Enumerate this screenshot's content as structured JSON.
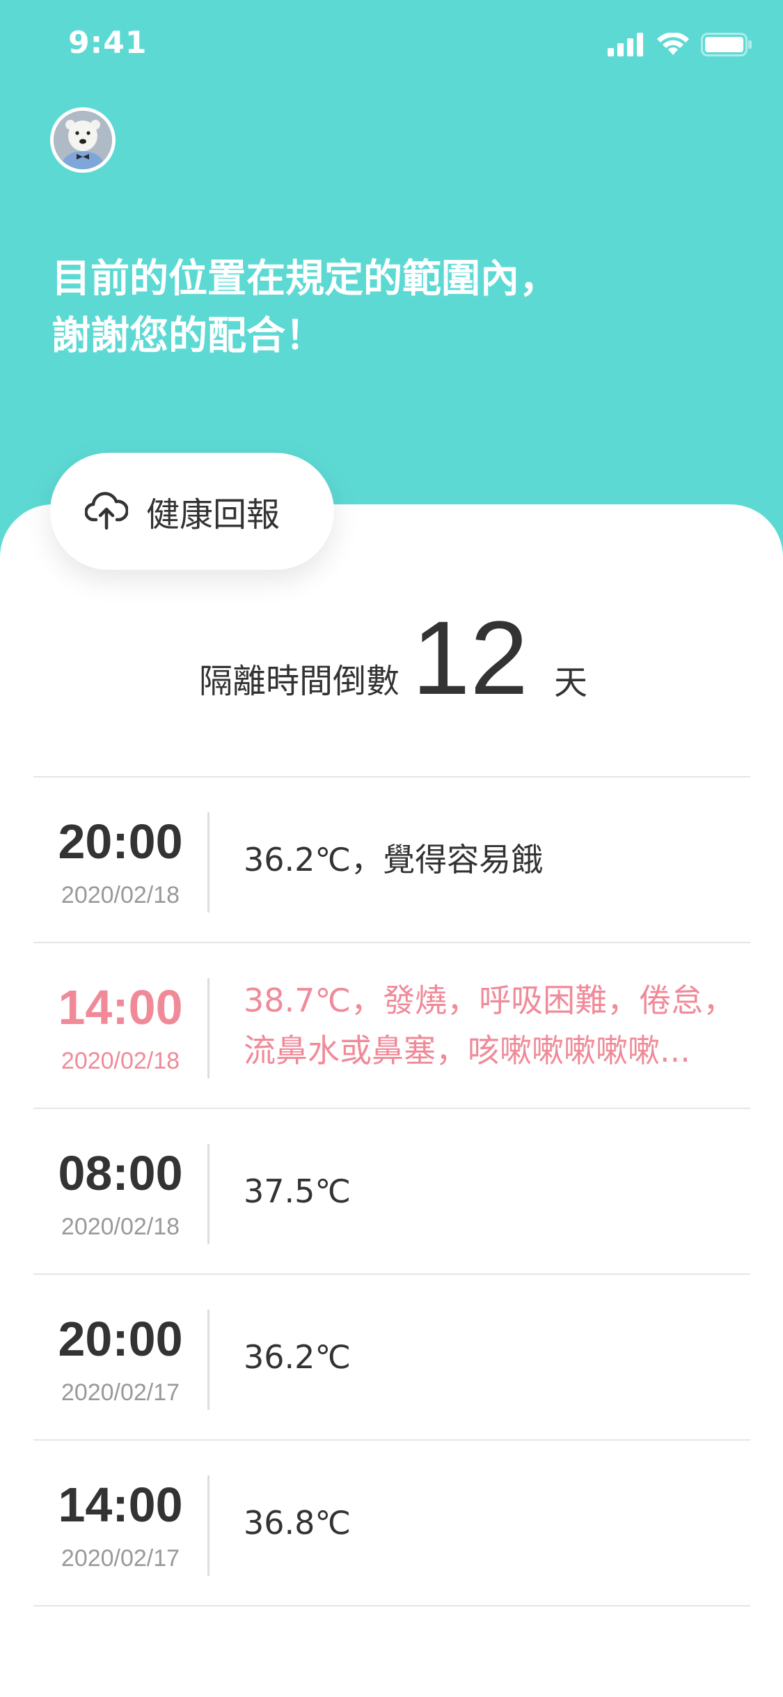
{
  "status_bar": {
    "time": "9:41",
    "signal_icon": "cellular-signal-icon",
    "wifi_icon": "wifi-icon",
    "battery_icon": "battery-icon"
  },
  "header": {
    "avatar_icon": "user-avatar",
    "message_line1": "目前的位置在規定的範圍內，",
    "message_line2": "謝謝您的配合！",
    "background_color": "#5DD9D4"
  },
  "report_button": {
    "label": "健康回報",
    "icon": "cloud-upload-icon"
  },
  "countdown": {
    "label": "隔離時間倒數",
    "value": "12",
    "unit": "天"
  },
  "records": [
    {
      "time": "20:00",
      "date": "2020/02/18",
      "description": "36.2℃，覺得容易餓",
      "alert": false
    },
    {
      "time": "14:00",
      "date": "2020/02/18",
      "description": "38.7℃，發燒，呼吸困難，倦怠，\n流鼻水或鼻塞，咳嗽嗽嗽嗽嗽...",
      "alert": true
    },
    {
      "time": "08:00",
      "date": "2020/02/18",
      "description": "37.5℃",
      "alert": false
    },
    {
      "time": "20:00",
      "date": "2020/02/17",
      "description": "36.2℃",
      "alert": false
    },
    {
      "time": "14:00",
      "date": "2020/02/17",
      "description": "36.8℃",
      "alert": false
    }
  ],
  "colors": {
    "accent": "#5DD9D4",
    "alert": "#F08A99",
    "text": "#333333",
    "muted": "#999999"
  }
}
